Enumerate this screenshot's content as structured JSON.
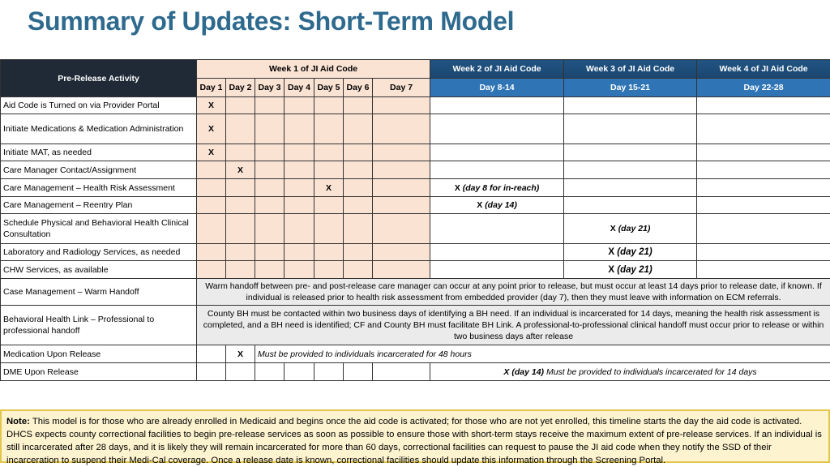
{
  "title": "Summary of Updates: Short-Term Model",
  "table": {
    "header": {
      "activity_label": "Pre-Release Activity",
      "week1_label": "Week 1 of JI Aid Code",
      "week2_label": "Week 2 of JI Aid Code",
      "week3_label": "Week 3 of JI Aid Code",
      "week4_label": "Week 4 of JI Aid Code",
      "days": [
        "Day 1",
        "Day 2",
        "Day 3",
        "Day 4",
        "Day 5",
        "Day 6",
        "Day 7"
      ],
      "week2_days": "Day 8-14",
      "week3_days": "Day 15-21",
      "week4_days": "Day 22-28"
    },
    "rows": [
      {
        "activity": "Aid Code is Turned on via Provider Portal",
        "marks": [
          "X",
          "",
          "",
          "",
          "",
          "",
          ""
        ],
        "week2": "",
        "week3": "",
        "week4": ""
      },
      {
        "activity": "Initiate Medications & Medication Administration",
        "marks": [
          "X",
          "",
          "",
          "",
          "",
          "",
          ""
        ],
        "week2": "",
        "week3": "",
        "week4": ""
      },
      {
        "activity": "Initiate MAT, as needed",
        "marks": [
          "X",
          "",
          "",
          "",
          "",
          "",
          ""
        ],
        "week2": "",
        "week3": "",
        "week4": ""
      },
      {
        "activity": "Care Manager Contact/Assignment",
        "marks": [
          "",
          "X",
          "",
          "",
          "",
          "",
          ""
        ],
        "week2": "",
        "week3": "",
        "week4": ""
      },
      {
        "activity": "Care Management – Health Risk Assessment",
        "marks": [
          "",
          "",
          "",
          "",
          "X",
          "",
          ""
        ],
        "week2_x": "X",
        "week2_note": "(day 8 for in-reach)",
        "week3": "",
        "week4": ""
      },
      {
        "activity": "Care Management – Reentry Plan",
        "marks": [
          "",
          "",
          "",
          "",
          "",
          "",
          ""
        ],
        "week2_x": "X",
        "week2_note": "(day 14)",
        "week3": "",
        "week4": ""
      },
      {
        "activity": "Schedule Physical and Behavioral Health Clinical Consultation",
        "marks": [
          "",
          "",
          "",
          "",
          "",
          "",
          ""
        ],
        "week2": "",
        "week3_x": "X",
        "week3_note": "(day 21)",
        "week4": ""
      },
      {
        "activity": "Laboratory and Radiology Services, as needed",
        "marks": [
          "",
          "",
          "",
          "",
          "",
          "",
          ""
        ],
        "week2": "",
        "week3_x": "X",
        "week3_note": "(day 21)",
        "week4": ""
      },
      {
        "activity": "CHW Services, as available",
        "marks": [
          "",
          "",
          "",
          "",
          "",
          "",
          ""
        ],
        "week2": "",
        "week3_x": "X",
        "week3_note": "(day 21)",
        "week4": ""
      },
      {
        "activity": "Case Management – Warm Handoff",
        "merged_text": "Warm handoff between pre- and post-release care manager can occur at any point prior to release, but must occur at least 14 days prior to release date, if known. If individual is released prior to health risk assessment from embedded provider (day 7), then they must leave with information on ECM referrals."
      },
      {
        "activity": "Behavioral Health Link – Professional to professional handoff",
        "merged_text": "County BH must be contacted within two business days of identifying a BH need. If an individual is incarcerated for 14 days, meaning the health risk assessment is completed, and a BH need is identified; CF and County BH must facilitate BH Link. A professional-to-professional clinical handoff must occur prior to release or within two business days after release"
      },
      {
        "activity": "Medication Upon Release",
        "day1": "",
        "day2": "X",
        "merged_text": "Must be provided to individuals incarcerated for 48 hours"
      },
      {
        "activity": "DME Upon Release",
        "marks": [
          "",
          "",
          "",
          "",
          "",
          "",
          ""
        ],
        "merged_x": "X (day 14)",
        "merged_text": "Must be provided to individuals incarcerated for 14 days"
      }
    ]
  },
  "note": {
    "label": "Note:",
    "text": "This model is for those who are already enrolled in Medicaid and begins once the aid code is activated; for those who are not yet enrolled, this timeline starts the day the aid code is activated. DHCS expects county correctional facilities to begin pre-release services as soon as possible to ensure those with short-term stays receive the maximum extent of pre-release services. If an individual is still incarcerated after 28 days, and it is likely they will remain incarcerated for more than 60 days, correctional facilities can request to pause the JI aid code when they notify the SSD of their incarceration to suspend their Medi-Cal coverage. Once a release date is known, correctional facilities should update this information through the Screening Portal."
  },
  "colors": {
    "title": "#2e6a8e",
    "header_dark": "#1f2a36",
    "week1_fill": "#fbe3d4",
    "week_header_blue": "#1f4e79",
    "day_header_blue": "#2f75b5",
    "merged_gray": "#ebebeb",
    "note_fill": "#fdf3cf",
    "note_border": "#e2c64a"
  }
}
